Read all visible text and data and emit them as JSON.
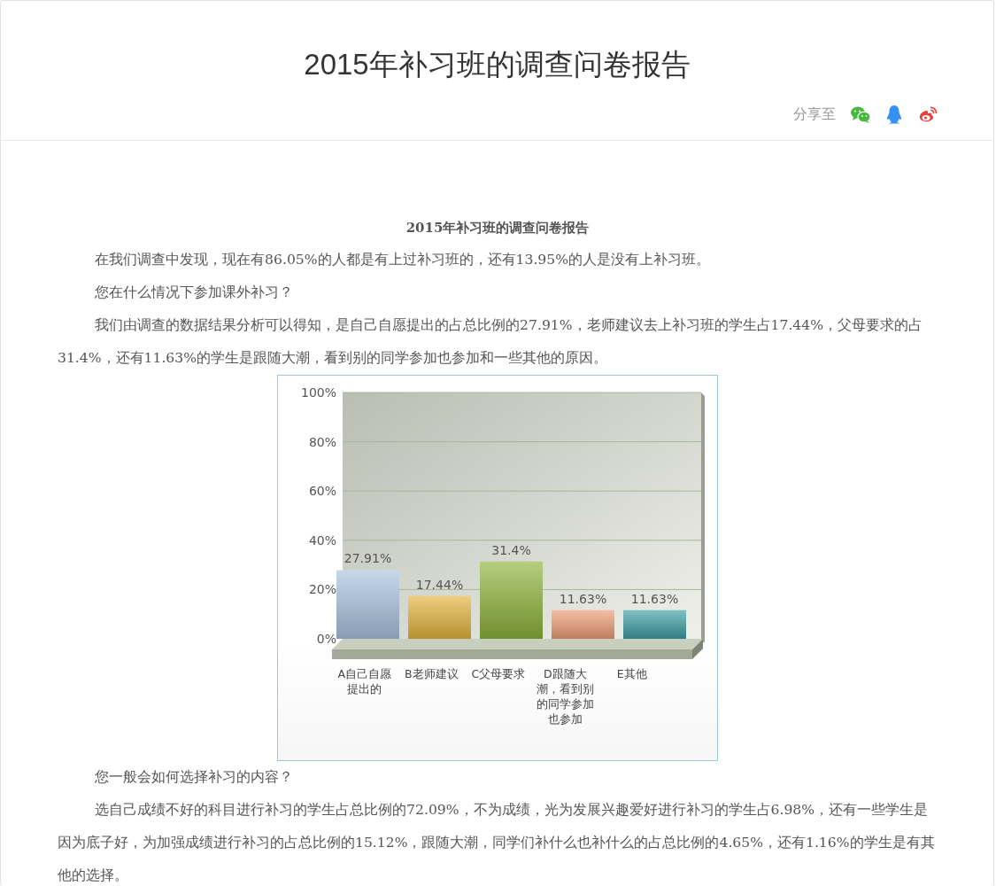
{
  "page_title": "2015年补习班的调查问卷报告",
  "share": {
    "label": "分享至",
    "icons": [
      {
        "kind": "wechat"
      },
      {
        "kind": "qq"
      },
      {
        "kind": "weibo"
      }
    ]
  },
  "article": [
    {
      "kind": "heading",
      "text": "2015年补习班的调查问卷报告"
    },
    {
      "kind": "paragraph",
      "text": "在我们调查中发现，现在有86.05%的人都是有上过补习班的，还有13.95%的人是没有上补习班。"
    },
    {
      "kind": "paragraph",
      "text": "您在什么情况下参加课外补习？"
    },
    {
      "kind": "paragraph",
      "text": "我们由调查的数据结果分析可以得知，是自己自愿提出的占总比例的27.91%，老师建议去上补习班的学生占17.44%，父母要求的占31.4%，还有11.63%的学生是跟随大潮，看到别的同学参加也参加和一些其他的原因。"
    },
    {
      "kind": "chart",
      "chart_data": {
        "type": "bar",
        "categories": [
          "A自己自愿提出的",
          "B老师建议",
          "C父母要求",
          "D跟随大潮，看到别的同学参加也参加",
          "E其他"
        ],
        "series": [
          {
            "values": [
              27.91,
              17.44,
              31.4,
              11.63,
              11.63
            ]
          }
        ],
        "grid": true,
        "colors": [
          "#a9c3df",
          "#e3b43c",
          "#8cb33a",
          "#ee9c74",
          "#3c9ea3"
        ],
        "value_labels": [
          "27.91%",
          "17.44%",
          "31.4%",
          "11.63%",
          "11.63%"
        ],
        "ylim": [
          0,
          100
        ],
        "yticks": [
          {
            "value": 0,
            "label": "0%"
          },
          {
            "value": 20,
            "label": "20%"
          },
          {
            "value": 40,
            "label": "40%"
          },
          {
            "value": 60,
            "label": "60%"
          },
          {
            "value": 80,
            "label": "80%"
          },
          {
            "value": 100,
            "label": "100%"
          }
        ]
      }
    },
    {
      "kind": "paragraph",
      "text": "您一般会如何选择补习的内容？"
    },
    {
      "kind": "paragraph",
      "text": "选自己成绩不好的科目进行补习的学生占总比例的72.09%，不为成绩，光为发展兴趣爱好进行补习的学生占6.98%，还有一些学生是因为底子好，为加强成绩进行补习的占总比例的15.12%，跟随大潮，同学们补什么也补什么的占总比例的4.65%，还有1.16%的学生是有其他的选择。"
    }
  ]
}
